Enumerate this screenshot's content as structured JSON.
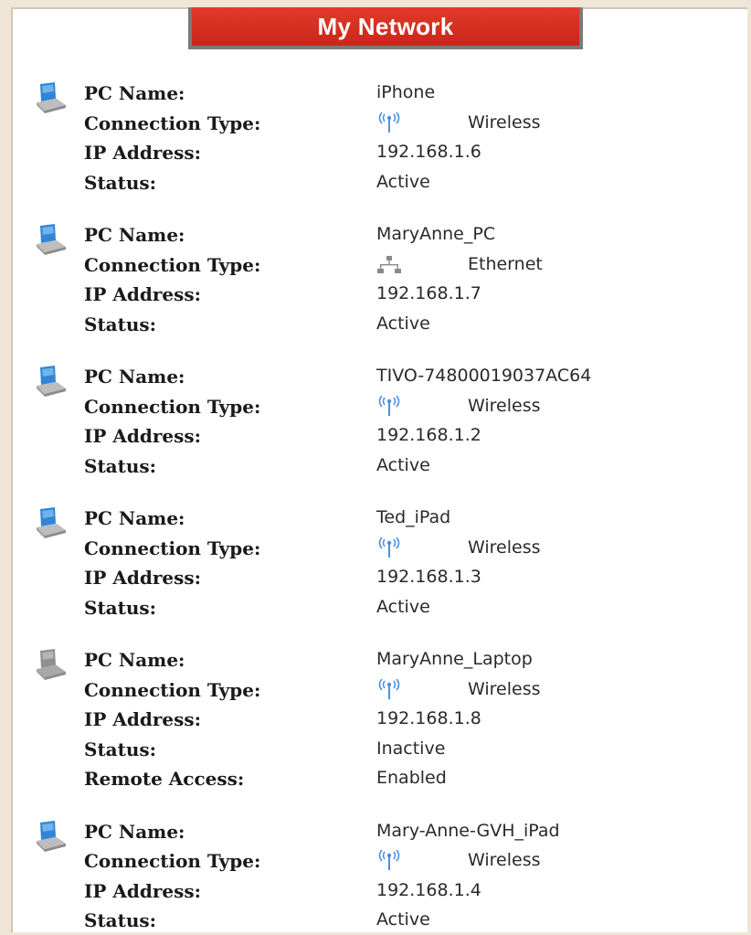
{
  "header": {
    "title": "My Network"
  },
  "labels": {
    "pc_name": "PC Name:",
    "connection_type": "Connection Type:",
    "ip_address": "IP Address:",
    "status": "Status:",
    "remote_access": "Remote Access:"
  },
  "devices": [
    {
      "icon": "computer-icon",
      "pc_name": "iPhone",
      "connection_icon": "wireless-icon",
      "connection_type": "Wireless",
      "ip_address": "192.168.1.6",
      "status": "Active"
    },
    {
      "icon": "computer-icon",
      "pc_name": "MaryAnne_PC",
      "connection_icon": "ethernet-icon",
      "connection_type": "Ethernet",
      "ip_address": "192.168.1.7",
      "status": "Active"
    },
    {
      "icon": "computer-icon",
      "pc_name": "TIVO-74800019037AC64",
      "connection_icon": "wireless-icon",
      "connection_type": "Wireless",
      "ip_address": "192.168.1.2",
      "status": "Active"
    },
    {
      "icon": "computer-icon",
      "pc_name": "Ted_iPad",
      "connection_icon": "wireless-icon",
      "connection_type": "Wireless",
      "ip_address": "192.168.1.3",
      "status": "Active"
    },
    {
      "icon": "computer-inactive-icon",
      "pc_name": "MaryAnne_Laptop",
      "connection_icon": "wireless-icon",
      "connection_type": "Wireless",
      "ip_address": "192.168.1.8",
      "status": "Inactive",
      "remote_access": "Enabled"
    },
    {
      "icon": "computer-icon",
      "pc_name": "Mary-Anne-GVH_iPad",
      "connection_icon": "wireless-icon",
      "connection_type": "Wireless",
      "ip_address": "192.168.1.4",
      "status": "Active"
    }
  ],
  "colors": {
    "title_bg": "#d8301f",
    "active_pc_blue": "#3a8fd8",
    "inactive_pc_gray": "#9a9a9a",
    "wireless_blue": "#4a90e2"
  }
}
